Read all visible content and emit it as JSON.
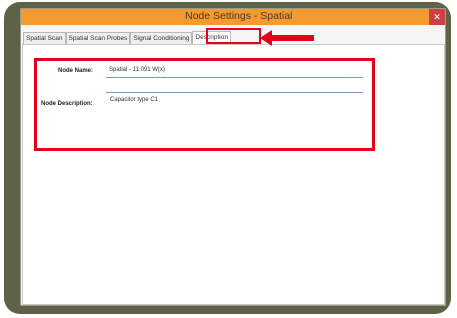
{
  "window": {
    "title": "Node Settings - Spatial",
    "close_glyph": "✕"
  },
  "tabs": [
    {
      "label": "Spatial Scan"
    },
    {
      "label": "Spatial Scan Probes"
    },
    {
      "label": "Signal Conditioning"
    },
    {
      "label": "Description"
    }
  ],
  "active_tab": "Description",
  "form": {
    "node_name_label": "Node Name:",
    "node_name_value": "Spatial - 11.091 W(x)",
    "node_description_label": "Node Description:",
    "node_description_value": "Capacitor type C1"
  },
  "annotations": {
    "highlight_color": "#e2001a",
    "arrow_icon": "left-arrow-icon"
  }
}
